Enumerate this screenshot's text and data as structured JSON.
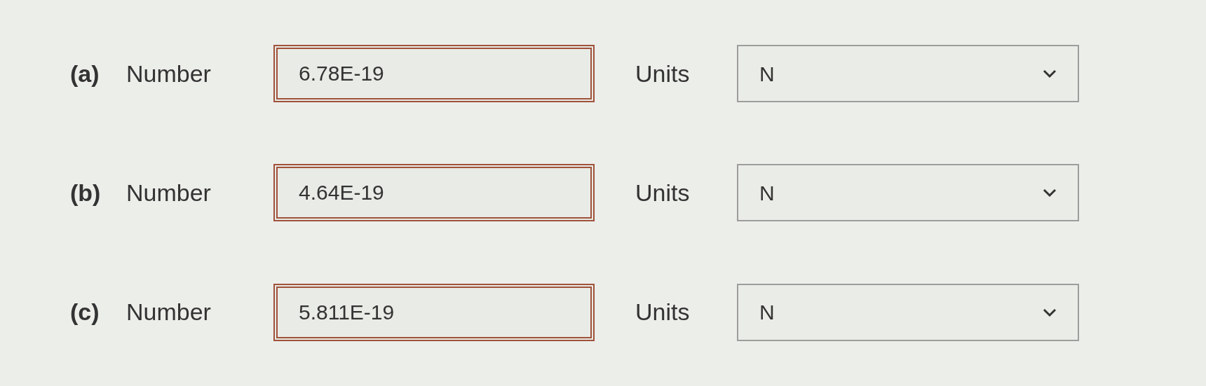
{
  "rows": [
    {
      "part": "(a)",
      "number_label": "Number",
      "value": "6.78E-19",
      "incorrect": true,
      "units_label": "Units",
      "unit": "N"
    },
    {
      "part": "(b)",
      "number_label": "Number",
      "value": "4.64E-19",
      "incorrect": true,
      "units_label": "Units",
      "unit": "N"
    },
    {
      "part": "(c)",
      "number_label": "Number",
      "value": "5.811E-19",
      "incorrect": true,
      "units_label": "Units",
      "unit": "N"
    }
  ]
}
